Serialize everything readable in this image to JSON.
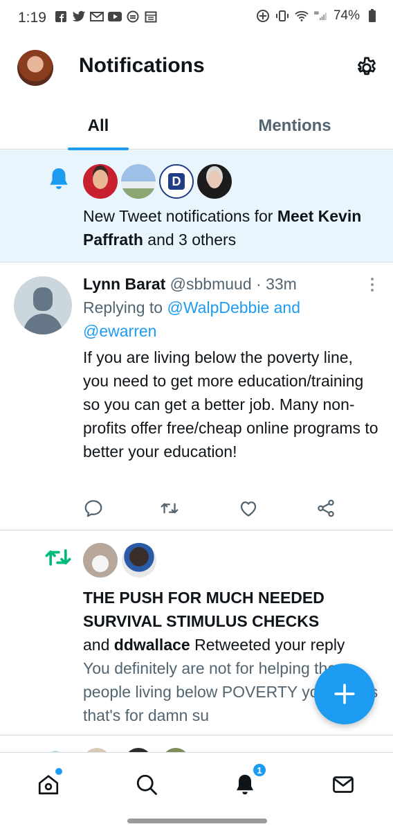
{
  "status_bar": {
    "time": "1:19",
    "battery": "74%",
    "left_icons": [
      "facebook-icon",
      "twitter-icon",
      "gmail-icon",
      "youtube-icon",
      "sync-icon",
      "calendar-icon"
    ],
    "right_icons": [
      "location-icon",
      "vibrate-icon",
      "wifi-icon",
      "signal-icon",
      "battery-icon"
    ]
  },
  "header": {
    "title": "Notifications"
  },
  "tabs": [
    {
      "label": "All",
      "selected": true
    },
    {
      "label": "Mentions",
      "selected": false
    }
  ],
  "notifications": {
    "new_tweets": {
      "prefix": "New Tweet notifications for ",
      "name": "Meet Kevin Paffrath",
      "suffix": " and 3 others",
      "avatar_text": "D"
    },
    "reply": {
      "name": "Lynn Barat",
      "handle": "@sbbmuud",
      "separator": " · ",
      "time": "33m",
      "replying_prefix": "Replying to ",
      "replying_to_1": "@WalpDebbie and",
      "replying_to_2": "@ewarren",
      "body": "If you are living below the poverty line, you need to get more education/training so you can get a better job. Many non-profits offer free/cheap online programs to better your education!"
    },
    "retweet": {
      "title": "THE PUSH FOR MUCH NEEDED SURVIVAL STIMULUS CHECKS",
      "and": "and ",
      "user": "ddwallace",
      "action": " Retweeted your reply",
      "quote": "You definitely are not for helping the people living below POVERTY young kids that's for damn su"
    }
  },
  "bottom_nav": {
    "notifications_badge": "1"
  },
  "colors": {
    "accent": "#1d9bf0",
    "highlight_bg": "#e8f5fd",
    "retweet_green": "#00ba7c",
    "secondary_text": "#536471"
  }
}
